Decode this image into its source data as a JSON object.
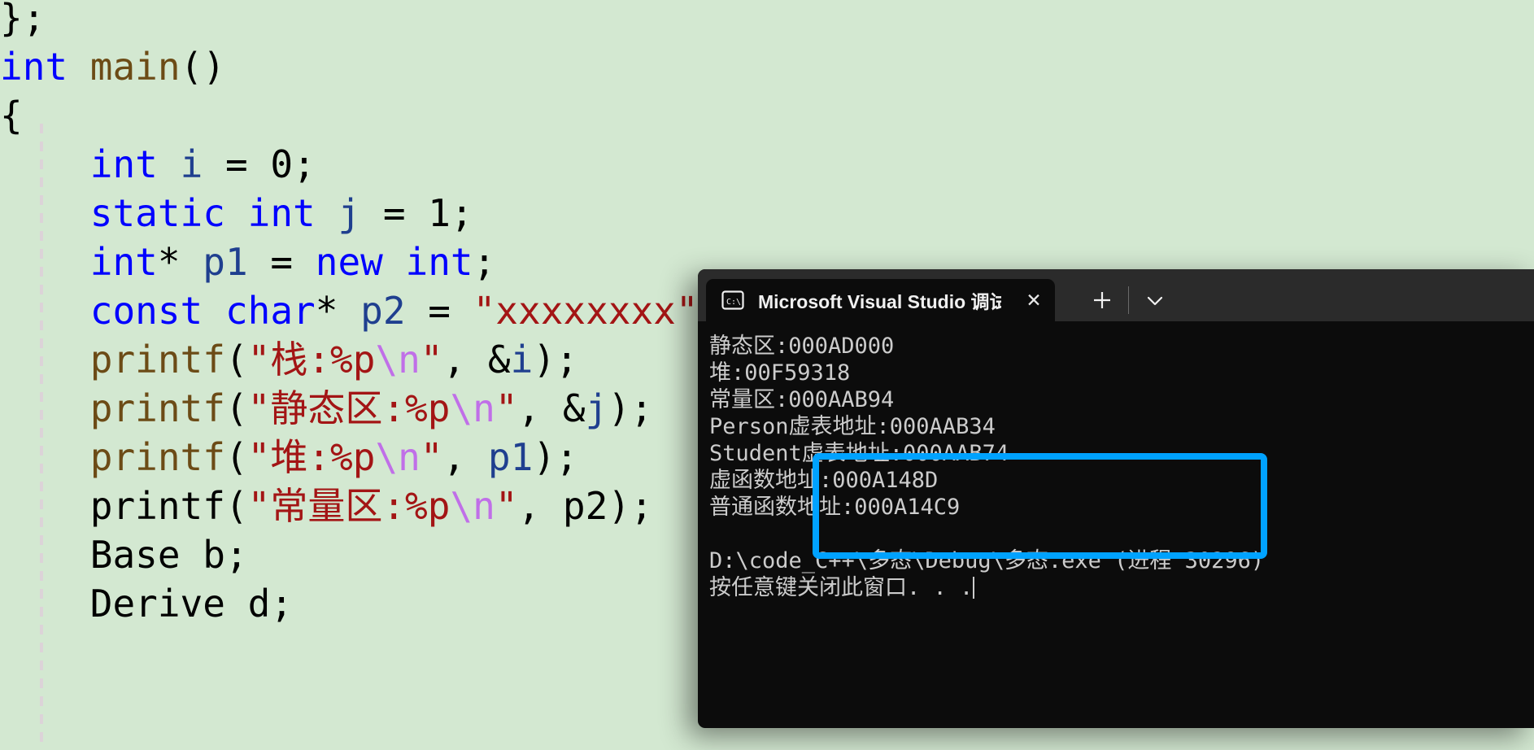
{
  "editor": {
    "background_color": "#d3e8d1",
    "colors": {
      "keyword": "#0000ff",
      "function": "#6c4b16",
      "string": "#a31515",
      "escape": "#c06fe8",
      "variable": "#1f3f8f",
      "plain": "#000000"
    },
    "code_lines": [
      {
        "id": "l1",
        "tokens": [
          {
            "t": "};",
            "c": "pl"
          }
        ]
      },
      {
        "id": "l2",
        "tokens": [
          {
            "t": "int ",
            "c": "kw"
          },
          {
            "t": "main",
            "c": "fn"
          },
          {
            "t": "()",
            "c": "pl"
          }
        ]
      },
      {
        "id": "l3",
        "tokens": [
          {
            "t": "{",
            "c": "pl"
          }
        ]
      },
      {
        "id": "l4",
        "tokens": [
          {
            "t": "    ",
            "c": "pl"
          },
          {
            "t": "int",
            "c": "kw"
          },
          {
            "t": " ",
            "c": "pl"
          },
          {
            "t": "i",
            "c": "var"
          },
          {
            "t": " = ",
            "c": "pl"
          },
          {
            "t": "0",
            "c": "num"
          },
          {
            "t": ";",
            "c": "pl"
          }
        ]
      },
      {
        "id": "l5",
        "tokens": [
          {
            "t": "    ",
            "c": "pl"
          },
          {
            "t": "static int",
            "c": "kw"
          },
          {
            "t": " ",
            "c": "pl"
          },
          {
            "t": "j",
            "c": "var"
          },
          {
            "t": " = ",
            "c": "pl"
          },
          {
            "t": "1",
            "c": "num"
          },
          {
            "t": ";",
            "c": "pl"
          }
        ]
      },
      {
        "id": "l6",
        "tokens": [
          {
            "t": "    ",
            "c": "pl"
          },
          {
            "t": "int",
            "c": "kw"
          },
          {
            "t": "* ",
            "c": "pl"
          },
          {
            "t": "p1",
            "c": "var"
          },
          {
            "t": " = ",
            "c": "pl"
          },
          {
            "t": "new int",
            "c": "kw"
          },
          {
            "t": ";",
            "c": "pl"
          }
        ]
      },
      {
        "id": "l7",
        "tokens": [
          {
            "t": "    ",
            "c": "pl"
          },
          {
            "t": "const char",
            "c": "kw"
          },
          {
            "t": "* ",
            "c": "pl"
          },
          {
            "t": "p2",
            "c": "var"
          },
          {
            "t": " = ",
            "c": "pl"
          },
          {
            "t": "\"xxxxxxxx\"",
            "c": "str"
          },
          {
            "t": ";",
            "c": "pl"
          }
        ]
      },
      {
        "id": "l8",
        "tokens": [
          {
            "t": "    ",
            "c": "pl"
          },
          {
            "t": "printf",
            "c": "fn"
          },
          {
            "t": "(",
            "c": "pl"
          },
          {
            "t": "\"栈:%p",
            "c": "str"
          },
          {
            "t": "\\n",
            "c": "esc"
          },
          {
            "t": "\"",
            "c": "str"
          },
          {
            "t": ", &",
            "c": "pl"
          },
          {
            "t": "i",
            "c": "var"
          },
          {
            "t": ");",
            "c": "pl"
          }
        ]
      },
      {
        "id": "l9",
        "tokens": [
          {
            "t": "    ",
            "c": "pl"
          },
          {
            "t": "printf",
            "c": "fn"
          },
          {
            "t": "(",
            "c": "pl"
          },
          {
            "t": "\"静态区:%p",
            "c": "str"
          },
          {
            "t": "\\n",
            "c": "esc"
          },
          {
            "t": "\"",
            "c": "str"
          },
          {
            "t": ", &",
            "c": "pl"
          },
          {
            "t": "j",
            "c": "var"
          },
          {
            "t": ");",
            "c": "pl"
          }
        ]
      },
      {
        "id": "l10",
        "tokens": [
          {
            "t": "    ",
            "c": "pl"
          },
          {
            "t": "printf",
            "c": "fn"
          },
          {
            "t": "(",
            "c": "pl"
          },
          {
            "t": "\"堆:%p",
            "c": "str"
          },
          {
            "t": "\\n",
            "c": "esc"
          },
          {
            "t": "\"",
            "c": "str"
          },
          {
            "t": ", ",
            "c": "pl"
          },
          {
            "t": "p1",
            "c": "var"
          },
          {
            "t": ");",
            "c": "pl"
          }
        ]
      },
      {
        "id": "l11",
        "tokens": [
          {
            "t": "    ",
            "c": "pl"
          },
          {
            "t": "printf",
            "c": "pl"
          },
          {
            "t": "(",
            "c": "pl"
          },
          {
            "t": "\"常量区:%p",
            "c": "str"
          },
          {
            "t": "\\n",
            "c": "esc"
          },
          {
            "t": "\"",
            "c": "str"
          },
          {
            "t": ", ",
            "c": "pl"
          },
          {
            "t": "p2",
            "c": "pl"
          },
          {
            "t": ");",
            "c": "pl"
          }
        ]
      },
      {
        "id": "l12",
        "tokens": [
          {
            "t": "    ",
            "c": "pl"
          },
          {
            "t": "Base b;",
            "c": "pl"
          }
        ]
      },
      {
        "id": "l13",
        "tokens": [
          {
            "t": "    ",
            "c": "pl"
          },
          {
            "t": "Derive d;",
            "c": "pl"
          }
        ]
      }
    ]
  },
  "terminal": {
    "tab": {
      "icon": "console-cmd-icon",
      "title": "Microsoft Visual Studio 调试控",
      "close_label": "✕"
    },
    "new_tab_label": "＋",
    "dropdown_label": "⌄",
    "console_lines": [
      "静态区:000AD000",
      "堆:00F59318",
      "常量区:000AAB94",
      "Person虚表地址:000AAB34",
      "Student虚表地址:000AAB74",
      "虚函数地址:000A148D",
      "普通函数地址:000A14C9",
      "",
      "D:\\code_C++\\多态\\Debug\\多态.exe (进程 30296)",
      "按任意键关闭此窗口. . ."
    ]
  },
  "annotation": {
    "highlight_color": "#00a2ff",
    "highlighted_lines": [
      "常量区:000AAB94",
      "Person虚表地址:000AAB34",
      "Student虚表地址:000AAB74"
    ]
  }
}
